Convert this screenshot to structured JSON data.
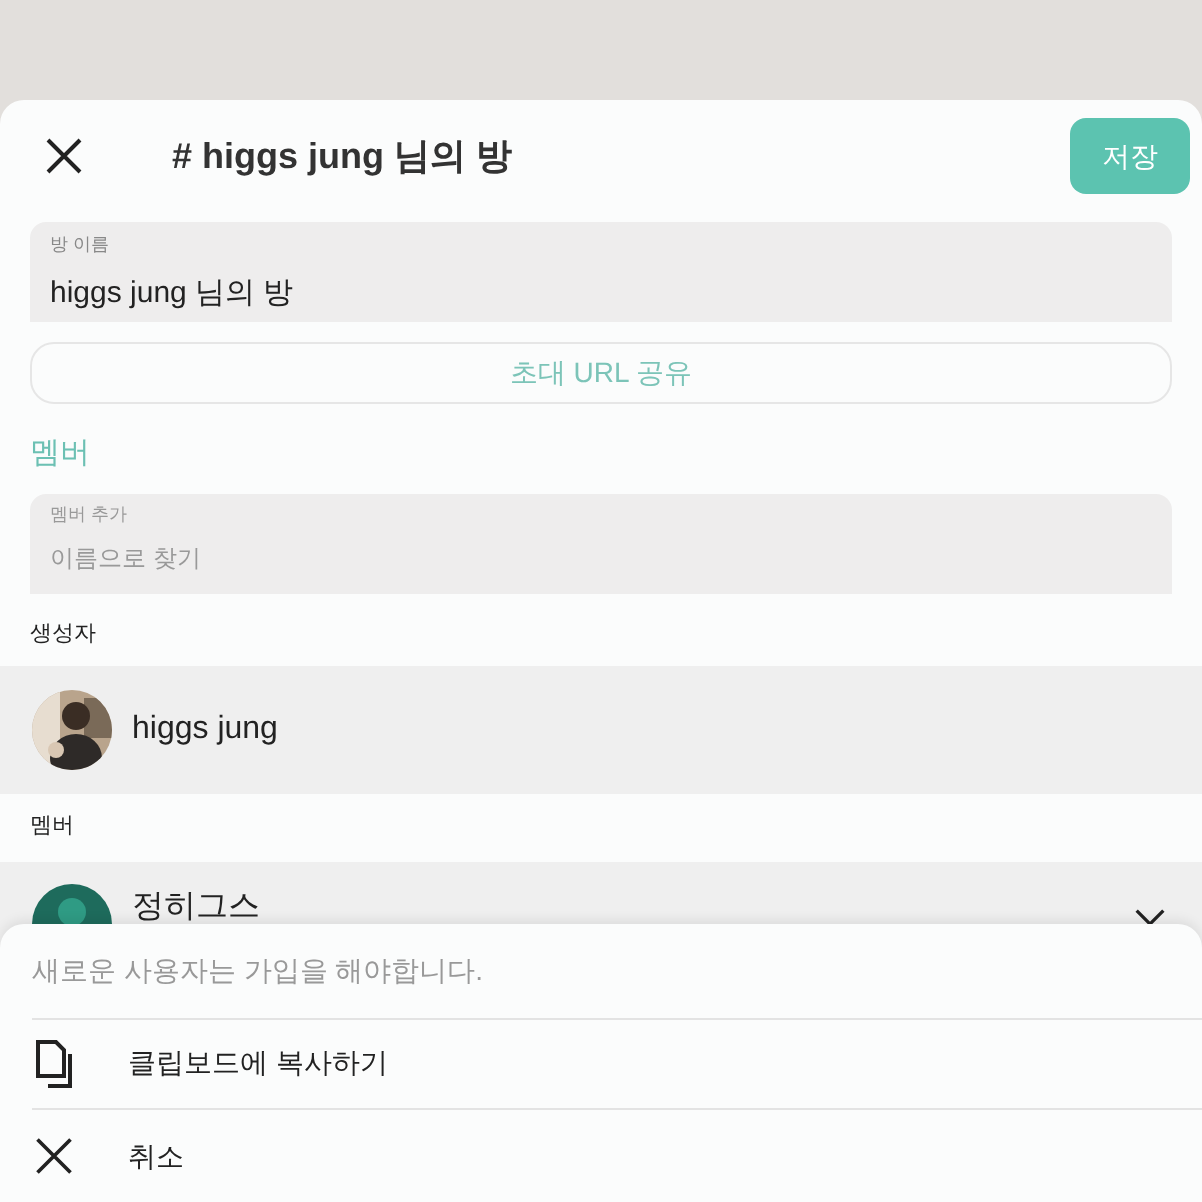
{
  "header": {
    "title": "# higgs jung 님의 방",
    "save": "저장"
  },
  "room_name": {
    "label": "방 이름",
    "value": "higgs jung 님의 방"
  },
  "invite_button": "초대 URL 공유",
  "members_heading": "멤버",
  "add_member": {
    "label": "멤버 추가",
    "placeholder": "이름으로 찾기"
  },
  "creator": {
    "heading": "생성자",
    "name": "higgs jung"
  },
  "members": {
    "heading": "멤버",
    "items": [
      {
        "name": "정히그스",
        "avatar": {
          "kind": "silhouette"
        }
      }
    ]
  },
  "sheet": {
    "note": "새로운 사용자는 가입을 해야합니다.",
    "actions": [
      {
        "kind": "copy",
        "label": "클립보드에 복사하기"
      },
      {
        "kind": "cancel",
        "label": "취소"
      }
    ]
  }
}
